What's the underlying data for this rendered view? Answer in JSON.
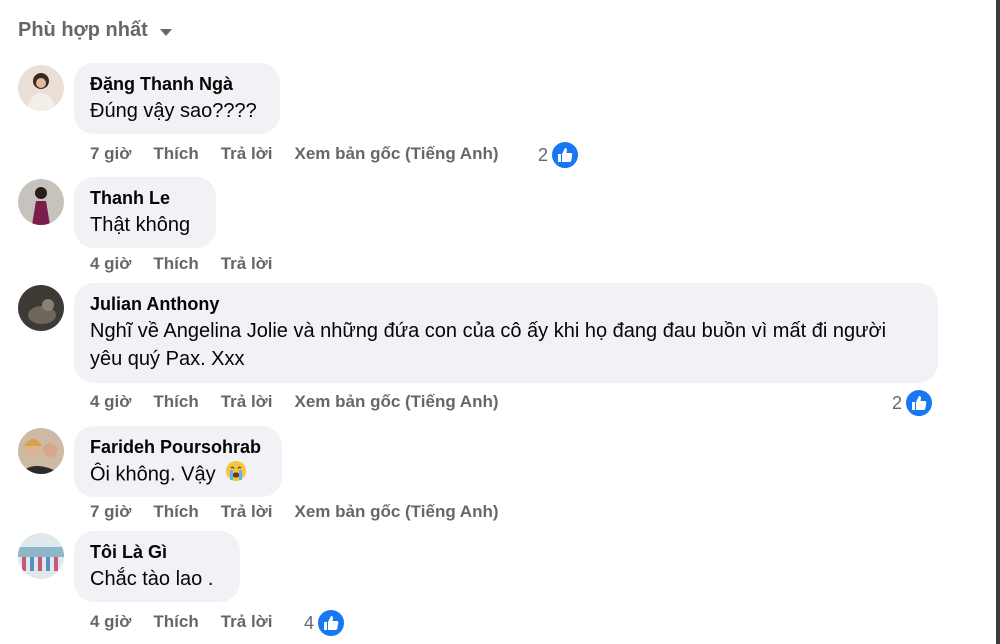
{
  "sort": {
    "label": "Phù hợp nhất"
  },
  "comments": [
    {
      "author": "Đặng Thanh Ngà",
      "text": "Đúng vậy sao????",
      "time": "7 giờ",
      "like": "Thích",
      "reply": "Trả lời",
      "see_original": "Xem bản gốc (Tiếng Anh)",
      "likes": "2"
    },
    {
      "author": "Thanh Le",
      "text": "Thật không",
      "time": "4 giờ",
      "like": "Thích",
      "reply": "Trả lời"
    },
    {
      "author": "Julian Anthony",
      "text": "Nghĩ về Angelina Jolie và những đứa con của cô ấy khi họ đang đau buồn vì mất đi người yêu quý Pax. Xxx",
      "time": "4 giờ",
      "like": "Thích",
      "reply": "Trả lời",
      "see_original": "Xem bản gốc (Tiếng Anh)",
      "likes": "2"
    },
    {
      "author": "Farideh Poursohrab",
      "text": "Ôi không. Vậy",
      "emoji": "crying-face",
      "time": "7 giờ",
      "like": "Thích",
      "reply": "Trả lời",
      "see_original": "Xem bản gốc (Tiếng Anh)"
    },
    {
      "author": "Tôi Là Gì",
      "text": "Chắc tào lao .",
      "time": "4 giờ",
      "like": "Thích",
      "reply": "Trả lời",
      "likes": "4"
    }
  ],
  "colors": {
    "bubble": "#f0f2f5",
    "meta": "#65676b",
    "like_blue": "#1877f2"
  }
}
